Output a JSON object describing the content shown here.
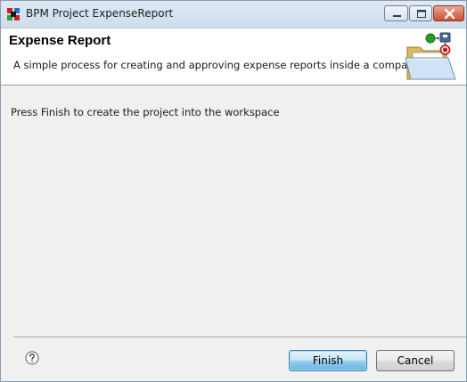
{
  "window": {
    "title": "BPM Project ExpenseReport",
    "icon": "bpm-app-icon",
    "controls": {
      "minimize_icon": "minimize-icon",
      "maximize_icon": "maximize-icon",
      "close_icon": "close-icon"
    }
  },
  "banner": {
    "title": "Expense Report",
    "description": "A simple process for creating and approving expense reports inside a company",
    "graphic_icon": "open-folder-process-icon"
  },
  "content": {
    "message": "Press Finish to create the project into the workspace"
  },
  "footer": {
    "help_icon": "help-icon",
    "finish_label": "Finish",
    "cancel_label": "Cancel"
  },
  "colors": {
    "titlebar": "#cddcee",
    "banner_bg": "#ffffff",
    "dialog_bg": "#f0f0f0",
    "close_button": "#c94f33",
    "default_button_border": "#3c7fb1"
  }
}
